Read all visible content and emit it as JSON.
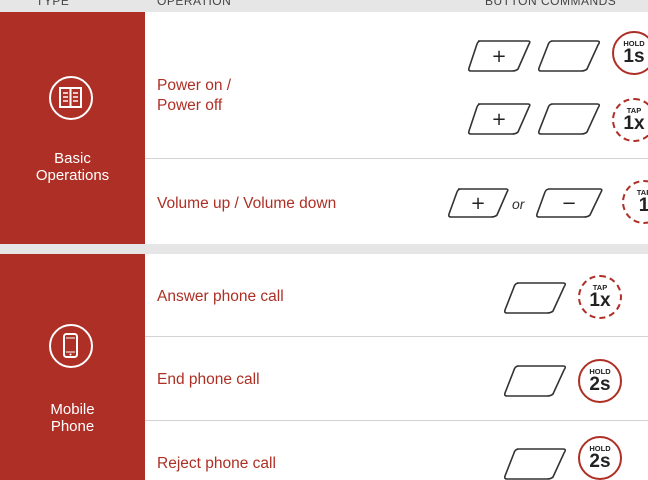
{
  "header": {
    "type_label": "TYPE",
    "operation_label": "OPERATION",
    "commands_label": "BUTTON COMMANDS"
  },
  "sections": [
    {
      "category": "Basic Operations",
      "category_line1": "Basic",
      "category_line2": "Operations",
      "icon": "book-icon"
    },
    {
      "category": "Mobile Phone",
      "category_line1": "Mobile",
      "category_line2": "Phone",
      "icon": "mobile-phone-icon"
    }
  ],
  "rows": [
    {
      "operation_line1": "Power on /",
      "operation_line2": "Power off"
    },
    {
      "operation": "Volume up / Volume down",
      "or_label": "or"
    },
    {
      "operation": "Answer phone call"
    },
    {
      "operation": "End phone call"
    },
    {
      "operation": "Reject phone call"
    }
  ],
  "badges": [
    {
      "small": "HOLD",
      "big": "1s"
    },
    {
      "small": "TAP",
      "big": "1x"
    },
    {
      "small": "TAP",
      "big": "1"
    },
    {
      "small": "TAP",
      "big": "1x"
    },
    {
      "small": "HOLD",
      "big": "2s"
    },
    {
      "small": "HOLD",
      "big": "2s"
    }
  ],
  "button_symbols": {
    "plus": "+",
    "minus": "−"
  },
  "colors": {
    "accent": "#ad2f25",
    "separator": "#e6e6e6",
    "divider": "#d3d3d3"
  }
}
